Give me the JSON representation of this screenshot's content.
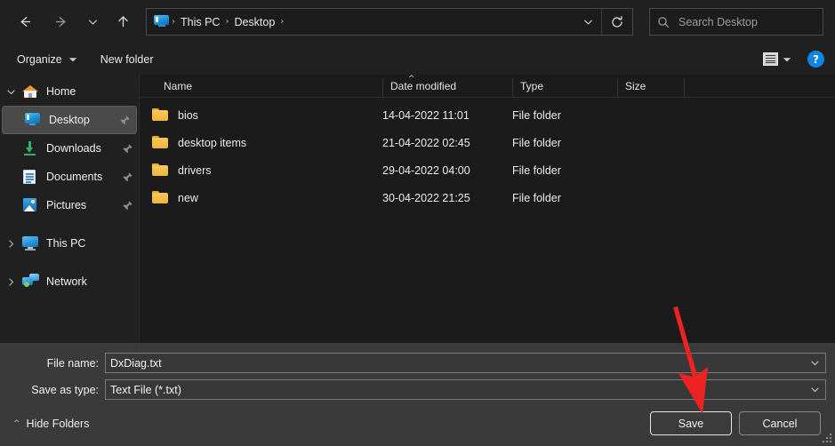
{
  "nav": {
    "back_icon": "arrow-left-icon",
    "forward_icon": "arrow-right-icon",
    "recent_icon": "chevron-down-icon",
    "up_icon": "arrow-up-icon",
    "refresh_icon": "refresh-icon",
    "address_dropdown_icon": "chevron-down-icon",
    "breadcrumb_icon": "desktop-icon",
    "breadcrumbs": [
      "This PC",
      "Desktop"
    ],
    "separator": "›",
    "trailing_separator": "›"
  },
  "search": {
    "icon": "search-icon",
    "placeholder": "Search Desktop",
    "value": ""
  },
  "toolbar": {
    "organize_label": "Organize",
    "organize_caret_icon": "chevron-down-icon",
    "new_folder_label": "New folder",
    "view_icon": "list-view-icon",
    "view_caret_icon": "chevron-down-icon",
    "help_label": "?",
    "help_icon": "help-icon",
    "accent_color": "#0e85e3"
  },
  "sidebar": {
    "items": [
      {
        "label": "Home",
        "icon": "home-icon",
        "chevron": "chevron-down-icon",
        "pinned": false,
        "selected": false,
        "indent": false
      },
      {
        "label": "Desktop",
        "icon": "desktop-icon",
        "chevron": "",
        "pinned": true,
        "selected": true,
        "indent": true
      },
      {
        "label": "Downloads",
        "icon": "downloads-icon",
        "chevron": "",
        "pinned": true,
        "selected": false,
        "indent": true
      },
      {
        "label": "Documents",
        "icon": "documents-icon",
        "chevron": "",
        "pinned": true,
        "selected": false,
        "indent": true
      },
      {
        "label": "Pictures",
        "icon": "pictures-icon",
        "chevron": "",
        "pinned": true,
        "selected": false,
        "indent": true
      },
      {
        "label": "This PC",
        "icon": "this-pc-icon",
        "chevron": "chevron-right-icon",
        "pinned": false,
        "selected": false,
        "indent": false
      },
      {
        "label": "Network",
        "icon": "network-icon",
        "chevron": "chevron-right-icon",
        "pinned": false,
        "selected": false,
        "indent": false
      }
    ],
    "pin_icon": "pin-icon"
  },
  "filelist": {
    "columns": [
      "Name",
      "Date modified",
      "Type",
      "Size"
    ],
    "sort_column": "Name",
    "sort_caret_icon": "caret-up-icon",
    "rows": [
      {
        "name": "bios",
        "date": "14-04-2022 11:01",
        "type": "File folder",
        "size": "",
        "icon": "folder-icon"
      },
      {
        "name": "desktop items",
        "date": "21-04-2022 02:45",
        "type": "File folder",
        "size": "",
        "icon": "folder-icon"
      },
      {
        "name": "drivers",
        "date": "29-04-2022 04:00",
        "type": "File folder",
        "size": "",
        "icon": "folder-icon"
      },
      {
        "name": "new",
        "date": "30-04-2022 21:25",
        "type": "File folder",
        "size": "",
        "icon": "folder-icon"
      }
    ]
  },
  "form": {
    "filename_label": "File name:",
    "filename_value": "DxDiag.txt",
    "filename_dropdown_icon": "chevron-down-icon",
    "savetype_label": "Save as type:",
    "savetype_value": "Text File (*.txt)",
    "savetype_dropdown_icon": "chevron-down-icon"
  },
  "footer": {
    "hide_folders_label": "Hide Folders",
    "hide_folders_caret_icon": "caret-up-icon",
    "save_label": "Save",
    "cancel_label": "Cancel",
    "resize_grip_icon": "resize-grip-icon"
  },
  "annotation": {
    "arrow_icon": "red-arrow-icon",
    "color": "#ee2222",
    "points_to": "Save"
  }
}
